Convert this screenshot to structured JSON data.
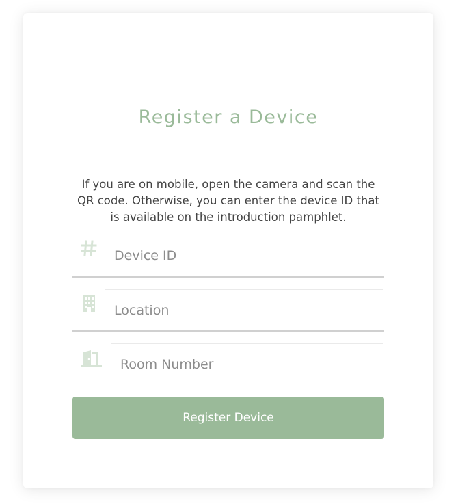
{
  "title": "Register a Device",
  "intro": "If you are on mobile, open the camera and scan the QR code. Otherwise, you can enter the device ID that is available on the introduction pamphlet.",
  "fields": {
    "device_id": {
      "placeholder": "Device ID",
      "value": "",
      "icon": "hash-icon"
    },
    "location": {
      "placeholder": "Location",
      "value": "",
      "icon": "building-icon"
    },
    "room_number": {
      "placeholder": "Room Number",
      "value": "",
      "icon": "door-icon"
    }
  },
  "submit_label": "Register Device",
  "colors": {
    "accent": "#9aba99",
    "icon": "#d7e4d6",
    "text": "#444444",
    "placeholder": "#8c8c8c",
    "divider": "#d0d0d0"
  }
}
